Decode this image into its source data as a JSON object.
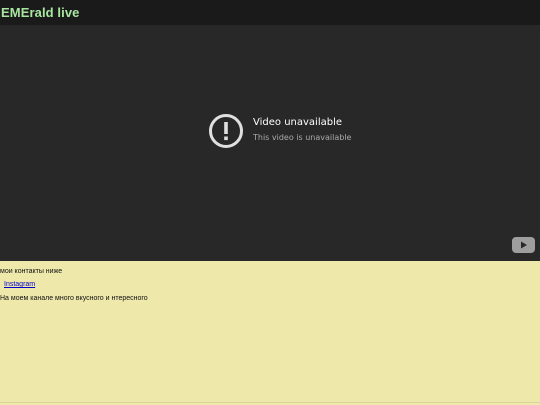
{
  "header": {
    "title": "EMErald live"
  },
  "video": {
    "error_title": "Video unavailable",
    "error_subtitle": "This video is unavailable",
    "error_icon": "exclamation-circle-icon",
    "logo_icon": "youtube-logo-icon"
  },
  "content": {
    "contacts_text": "мои контакты ниже",
    "link_label": "Instagram",
    "description": "На моем канале много вкусного и нтересного"
  },
  "colors": {
    "header_bg": "#1a1a1a",
    "title": "#a8e6a0",
    "player_bg": "#282828",
    "page_bg": "#eee8aa",
    "link": "#0000cc"
  }
}
